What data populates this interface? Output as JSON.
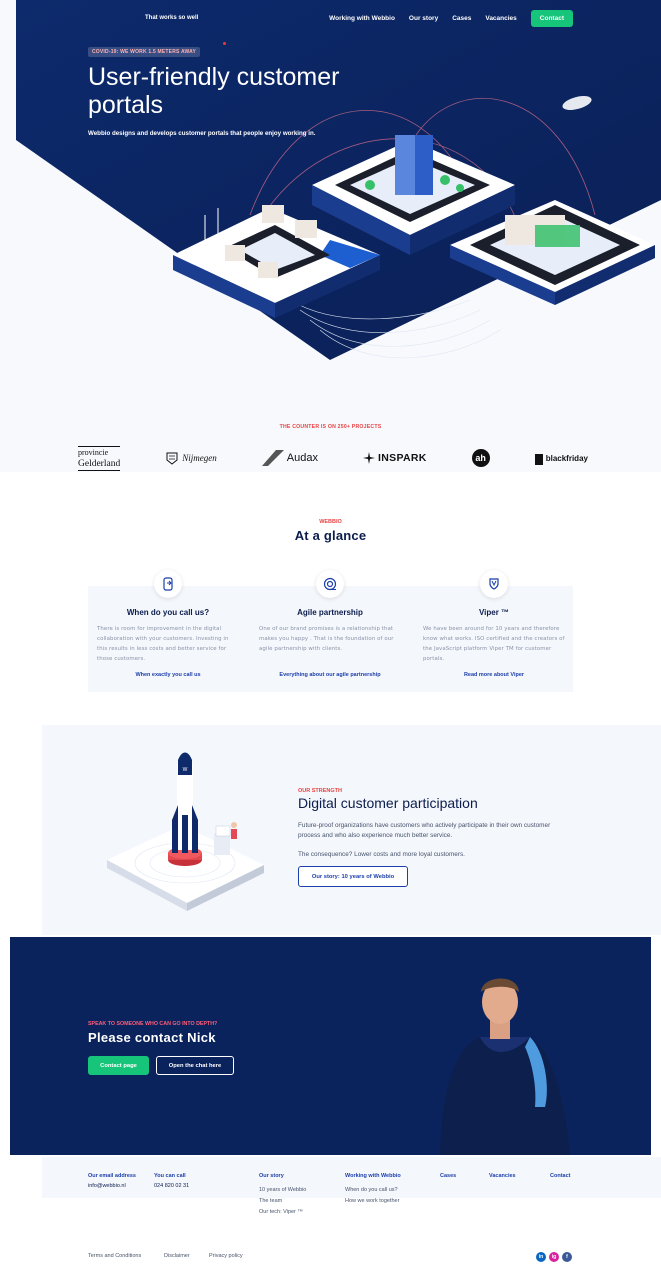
{
  "header": {
    "tagline": "That works so well",
    "nav": [
      "Working with Webbio",
      "Our story",
      "Cases",
      "Vacancies"
    ],
    "contact_label": "Contact"
  },
  "hero": {
    "badge": "COVID-19: WE WORK 1.5 METERS AWAY",
    "title": "User-friendly customer portals",
    "subtitle": "Webbio designs and develops customer portals that people enjoy working in."
  },
  "clients": {
    "label": "THE COUNTER IS ON 250+ PROJECTS",
    "logos": [
      {
        "line1": "provincie",
        "line2": "Gelderland"
      },
      {
        "name": "Nijmegen"
      },
      {
        "name": "Audax"
      },
      {
        "name": "INSPARK"
      },
      {
        "name": "ah"
      },
      {
        "name": "blackfriday"
      }
    ]
  },
  "glance": {
    "eyebrow": "WEBBIO",
    "title": "At a glance",
    "cards": [
      {
        "icon": "phone-icon",
        "title": "When do you call us?",
        "text": "There is room for improvement in the digital collaboration with your customers. Investing in this results in less costs and better service for those customers.",
        "link": "When exactly you call us"
      },
      {
        "icon": "target-icon",
        "title": "Agile partnership",
        "text": "One of our brand promises is a relationship that makes you happy . That is the foundation of our agile partnership with clients.",
        "link": "Everything about our agile partnership"
      },
      {
        "icon": "shield-icon",
        "title": "Viper ™",
        "text": "We have been around for 10 years and therefore know what works. ISO certified and the creators of the JavaScript platform Viper TM for customer portals.",
        "link": "Read more about Viper"
      }
    ]
  },
  "strength": {
    "eyebrow": "OUR STRENGTH",
    "title": "Digital customer participation",
    "p1": "Future-proof organizations have customers who actively participate in their own customer process and who also experience much better service.",
    "p2": "The consequence? Lower costs and more loyal customers.",
    "button": "Our story: 10 years of Webbio"
  },
  "contact": {
    "eyebrow": "SPEAK TO SOMEONE WHO CAN GO INTO DEPTH?",
    "title": "Please contact Nick",
    "primary": "Contact page",
    "secondary": "Open the chat here"
  },
  "footer": {
    "email_label": "Our email address",
    "email": "info@webbio.nl",
    "phone_label": "You can call",
    "phone": "024 820 02 31",
    "our_story": {
      "title": "Our story",
      "items": [
        "10 years of Webbio",
        "The team",
        "Our tech: Viper ™"
      ]
    },
    "working": {
      "title": "Working with Webbio",
      "items": [
        "When do you call us?",
        "How we work together"
      ]
    },
    "cases": "Cases",
    "vacancies": "Vacancies",
    "contact": "Contact",
    "legal": [
      "Terms and Conditions",
      "Disclaimer",
      "Privacy policy"
    ],
    "social": [
      {
        "icon": "linkedin-icon",
        "label": "in",
        "color": "#0a66c2"
      },
      {
        "icon": "instagram-icon",
        "label": "ig",
        "color": "#d6249f"
      },
      {
        "icon": "facebook-icon",
        "label": "f",
        "color": "#3b5998"
      }
    ]
  }
}
